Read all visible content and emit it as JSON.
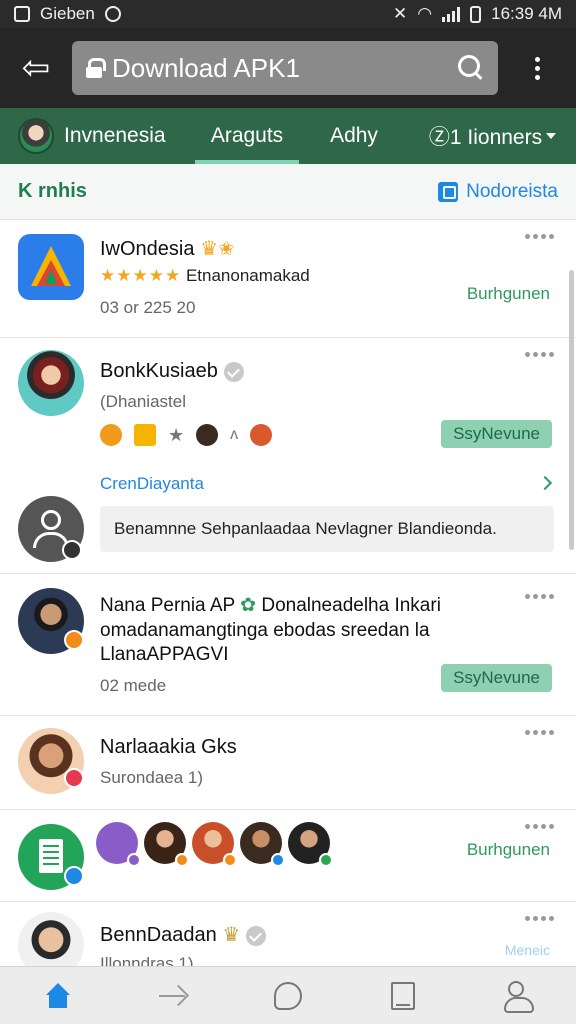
{
  "status_bar": {
    "left_text": "Gieben",
    "time": "16:39 4M"
  },
  "address_bar": {
    "url": "Download APK1"
  },
  "tabs": [
    {
      "label": "Invnenesia"
    },
    {
      "label": "Araguts"
    },
    {
      "label": "Adhy"
    },
    {
      "label": "Ⓩ1 Iionners"
    }
  ],
  "subheader": {
    "title": "K rnhis",
    "right_label": "Nodoreista"
  },
  "feed": {
    "item1": {
      "name": "IwOndesia",
      "rating_text": "Etnanonamakad",
      "meta": "03 or 225 20",
      "action": "Burhgunen"
    },
    "item2": {
      "name": "BonkKusiaeb",
      "subtitle": "(Dhaniastel",
      "pill": "SsyNevune",
      "link": "CrenDiayanta",
      "comment": "Benamnne Sehpanlaadaa Nevlagner Blandieonda."
    },
    "item3": {
      "text_line1": "Nana Pernia AP",
      "text_line1b": "Donalneadelha Inkari",
      "text_line2": "omadanamangtinga ebodas sreedan la",
      "text_line3": "LlanaAPPAGVI",
      "meta": "02 mede",
      "pill": "SsyNevune"
    },
    "item4": {
      "name": "Narlaaakia Gks",
      "subtitle": "Surondaea 1)"
    },
    "item5": {
      "action": "Burhgunen"
    },
    "item6": {
      "name": "BennDaadan",
      "subtitle": "Illonndras 1)",
      "action": "Meneic"
    }
  },
  "colors": {
    "brand_green": "#2f6848",
    "accent_blue": "#1e88e5",
    "action_green": "#2e9a5e"
  },
  "icons": {
    "back": "back-arrow-icon",
    "search": "search-icon",
    "menu": "overflow-menu-icon",
    "home": "home-icon",
    "forward": "forward-icon",
    "chat": "chat-icon",
    "book": "book-icon",
    "profile": "profile-icon"
  }
}
